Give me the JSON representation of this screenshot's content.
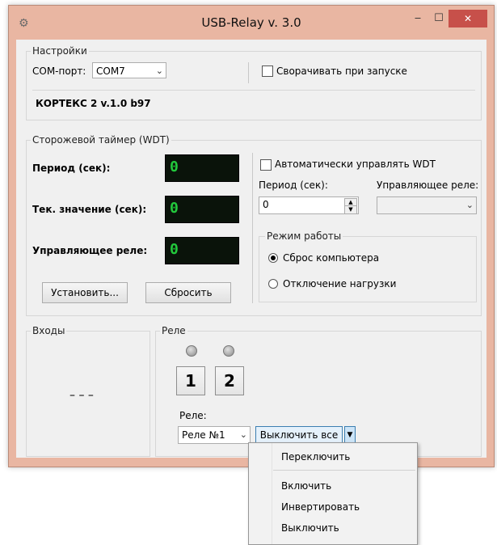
{
  "window": {
    "title": "USB-Relay v. 3.0",
    "minimize": "‒",
    "maximize": "☐",
    "close": "✕",
    "app_icon": "gear-icon"
  },
  "settings": {
    "group_label": "Настройки",
    "com_label": "COM-порт:",
    "com_value": "COM7",
    "minimize_on_start": "Сворачивать при запуске",
    "device_info": "КОРТЕКС 2 v.1.0 b97"
  },
  "wdt": {
    "group_label": "Сторожевой таймер (WDT)",
    "period_label": "Период (сек):",
    "period_display": "0",
    "current_label": "Тек. значение (сек):",
    "current_display": "0",
    "relay_label": "Управляющее реле:",
    "relay_display": "0",
    "set_button": "Установить...",
    "reset_button": "Сбросить",
    "auto_label": "Автоматически управлять WDT",
    "period_input_label": "Период (сек):",
    "period_input_value": "0",
    "relay_select_label": "Управляющее реле:",
    "relay_select_value": "",
    "mode_label": "Режим работы",
    "mode_reset": "Сброс компьютера",
    "mode_disconnect": "Отключение нагрузки"
  },
  "inputs": {
    "group_label": "Входы",
    "value": "– – –"
  },
  "relays": {
    "group_label": "Реле",
    "buttons": [
      "1",
      "2"
    ],
    "select_label": "Реле:",
    "select_value": "Реле №1",
    "off_all_button": "Выключить все"
  },
  "menu": {
    "items": [
      "Переключить",
      "Включить",
      "Инвертировать",
      "Выключить"
    ]
  }
}
